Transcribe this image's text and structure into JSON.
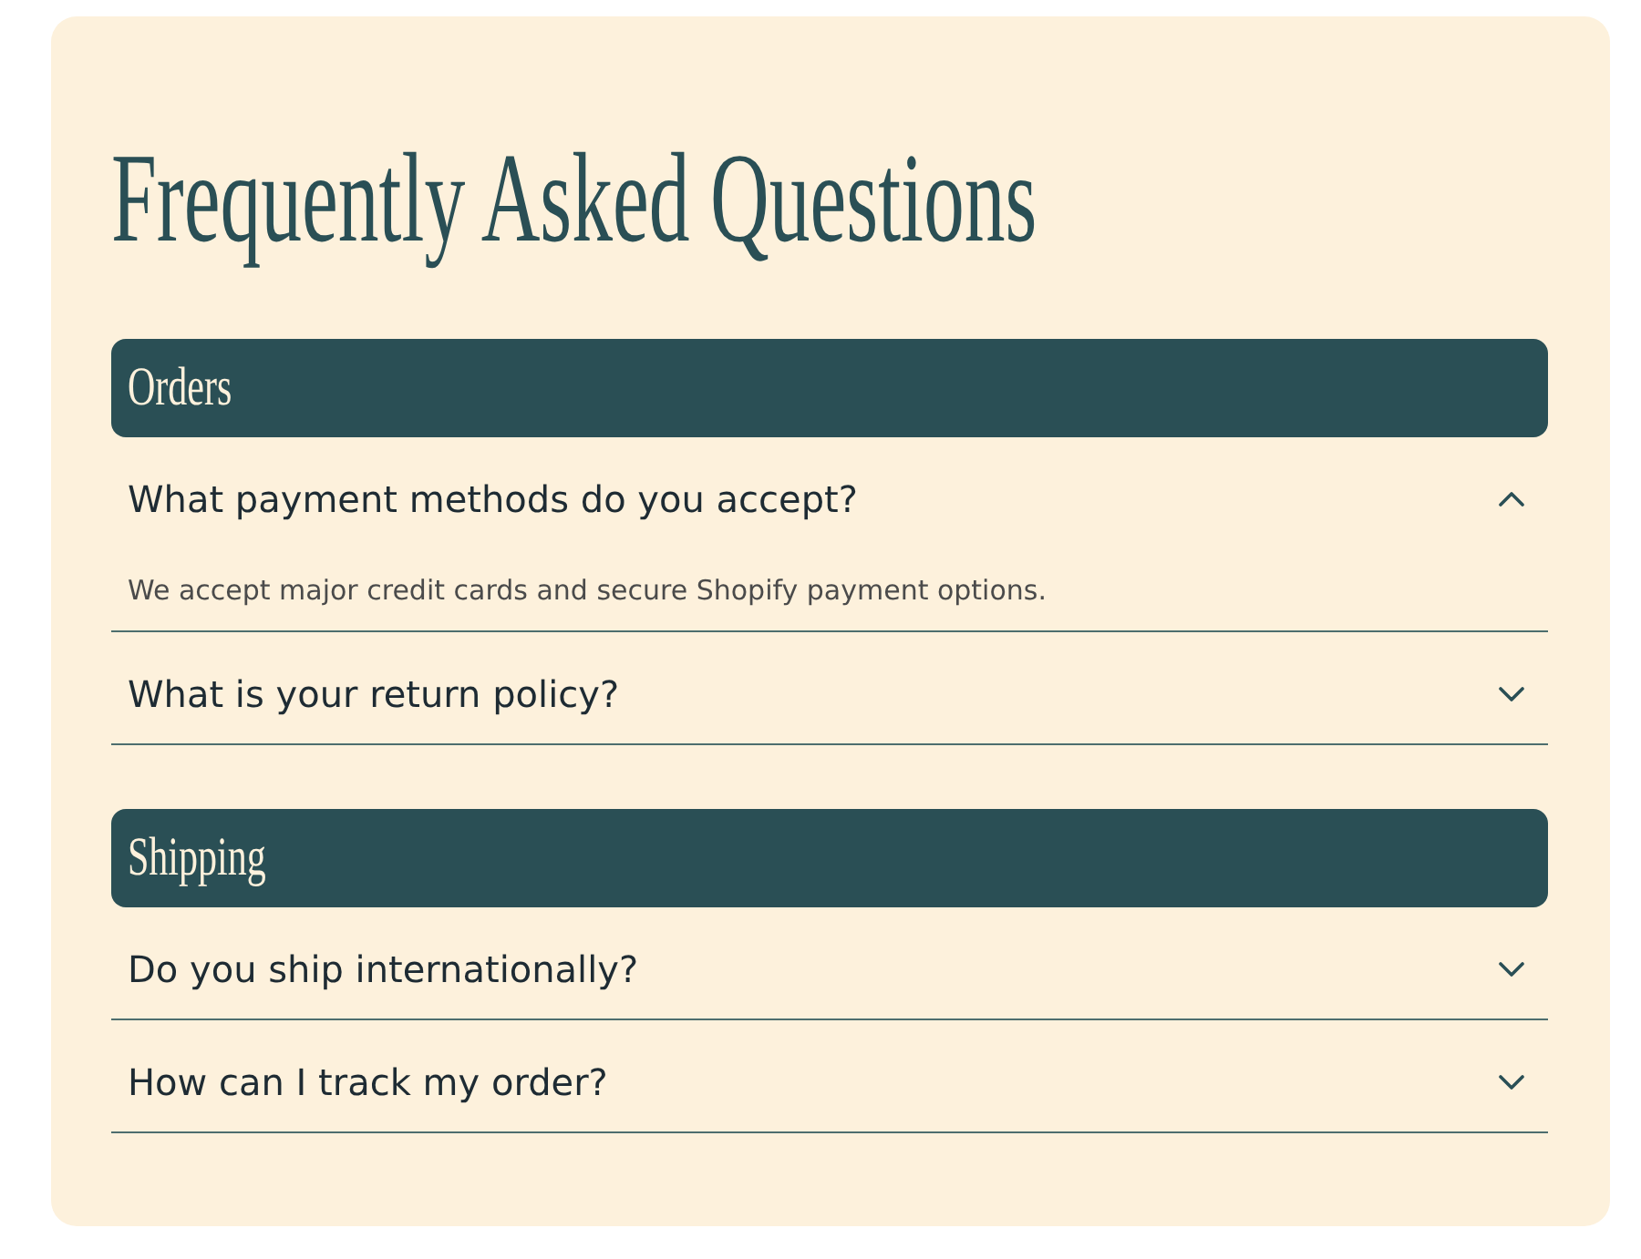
{
  "title": "Frequently Asked Questions",
  "sections": [
    {
      "heading": "Orders",
      "items": [
        {
          "question": "What payment methods do you accept?",
          "expanded": true,
          "answer": "We accept major credit cards and secure Shopify payment options."
        },
        {
          "question": "What is your return policy?",
          "expanded": false
        }
      ]
    },
    {
      "heading": "Shipping",
      "items": [
        {
          "question": "Do you ship internationally?",
          "expanded": false
        },
        {
          "question": "How can I track my order?",
          "expanded": false
        }
      ]
    }
  ]
}
